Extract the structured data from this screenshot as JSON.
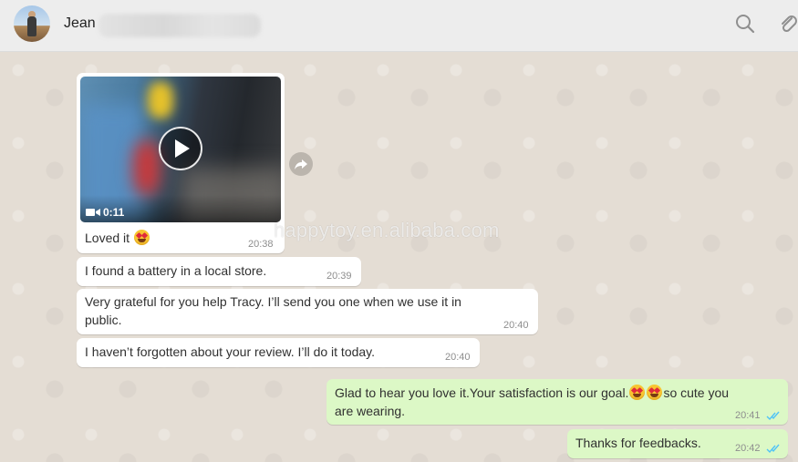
{
  "header": {
    "contact_name": "Jean",
    "icons": [
      "search-icon",
      "paperclip-icon"
    ]
  },
  "messages": [
    {
      "dir": "in",
      "type": "video",
      "duration": "0:11",
      "caption": "Loved it",
      "emoji": [
        "heart-eyes"
      ],
      "time": "20:38"
    },
    {
      "dir": "in",
      "text": "I found a battery in a local store.",
      "time": "20:39"
    },
    {
      "dir": "in",
      "text_lines": [
        "Very grateful for you help Tracy. I’ll send you one when we use it in",
        "public."
      ],
      "time": "20:40"
    },
    {
      "dir": "in",
      "text": "I haven’t forgotten about your review. I’ll do it today.",
      "time": "20:40"
    },
    {
      "dir": "out",
      "text_before": "Glad to hear you love it.Your satisfaction is our goal.",
      "emoji": [
        "heart-eyes",
        "heart-eyes"
      ],
      "text_after": "so cute you",
      "text_line2": "are wearing.",
      "time": "20:41",
      "status": "read"
    },
    {
      "dir": "out",
      "text": "Thanks for feedbacks.",
      "time": "20:42",
      "status": "read"
    }
  ],
  "watermark": "happytoy.en.alibaba.com",
  "colors": {
    "incoming_bg": "#ffffff",
    "outgoing_bg": "#dcf8c6",
    "read_ticks": "#4fc3f7",
    "chat_bg": "#e4ddd4"
  }
}
